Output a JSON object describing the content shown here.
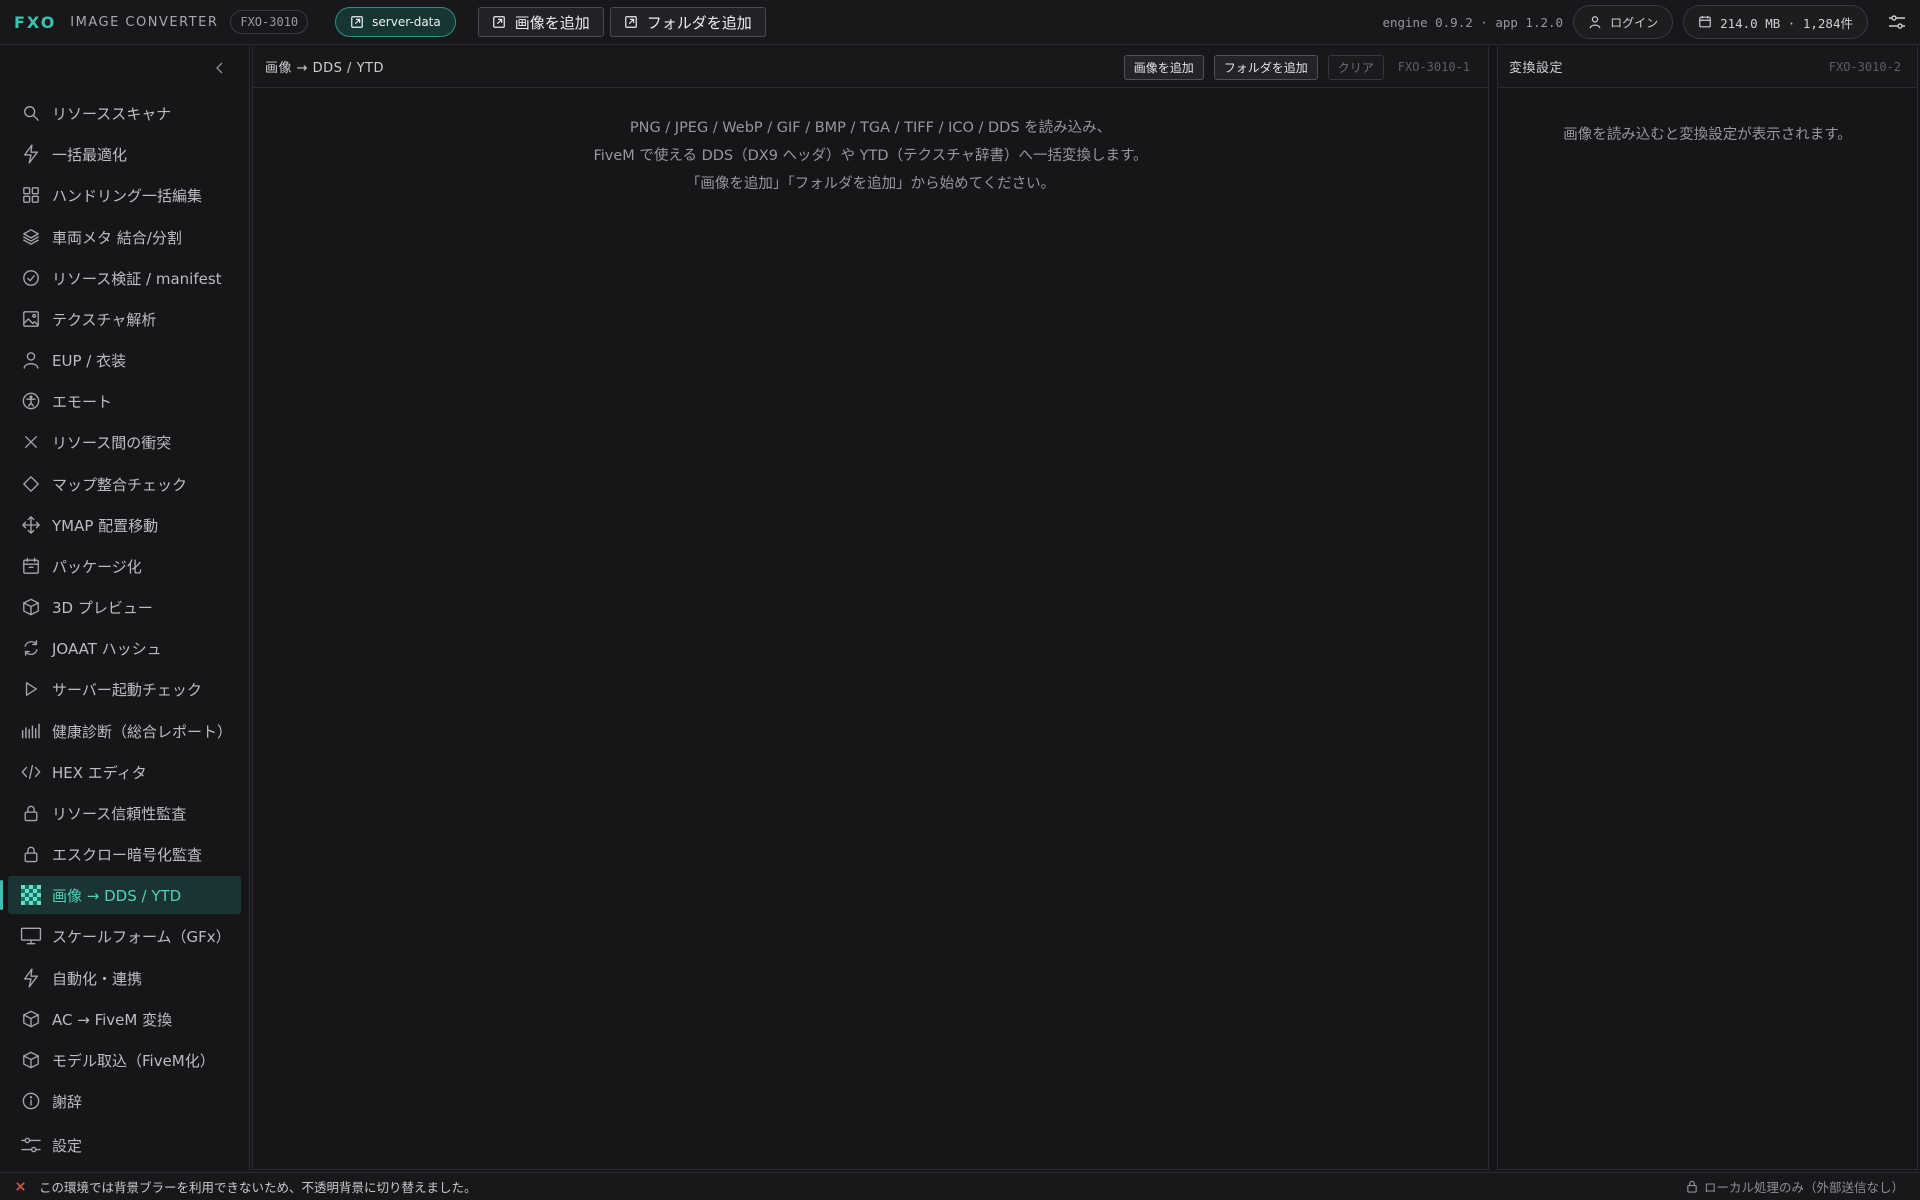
{
  "topbar": {
    "logo": "FXO",
    "app_name": "IMAGE CONVERTER",
    "app_code": "FXO-3010",
    "server_label": "server-data",
    "add_image_label": "画像を追加",
    "add_folder_label": "フォルダを追加",
    "version": "engine 0.9.2 · app 1.2.0",
    "login_label": "ログイン",
    "storage": "214.0 MB · 1,284件"
  },
  "sidebar": {
    "items": [
      {
        "label": "リソーススキャナ",
        "icon": "search-icon"
      },
      {
        "label": "一括最適化",
        "icon": "lightning-icon"
      },
      {
        "label": "ハンドリング一括編集",
        "icon": "grid-icon"
      },
      {
        "label": "車両メタ 結合/分割",
        "icon": "layers-icon"
      },
      {
        "label": "リソース検証 / manifest",
        "icon": "check-circle-icon"
      },
      {
        "label": "テクスチャ解析",
        "icon": "image-icon"
      },
      {
        "label": "EUP / 衣装",
        "icon": "user-icon"
      },
      {
        "label": "エモート",
        "icon": "accessibility-icon"
      },
      {
        "label": "リソース間の衝突",
        "icon": "x-icon"
      },
      {
        "label": "マップ整合チェック",
        "icon": "diamond-icon"
      },
      {
        "label": "YMAP 配置移動",
        "icon": "move-icon"
      },
      {
        "label": "パッケージ化",
        "icon": "package-icon"
      },
      {
        "label": "3D プレビュー",
        "icon": "cube-icon"
      },
      {
        "label": "JOAAT ハッシュ",
        "icon": "refresh-icon"
      },
      {
        "label": "サーバー起動チェック",
        "icon": "play-icon"
      },
      {
        "label": "健康診断（総合レポート）",
        "icon": "bars-icon"
      },
      {
        "label": "HEX エディタ",
        "icon": "code-icon"
      },
      {
        "label": "リソース信頼性監査",
        "icon": "lock-icon"
      },
      {
        "label": "エスクロー暗号化監査",
        "icon": "lock-icon"
      },
      {
        "label": "画像 → DDS / YTD",
        "icon": "checker-icon",
        "active": true
      },
      {
        "label": "スケールフォーム（GFx）",
        "icon": "monitor-icon"
      },
      {
        "label": "自動化・連携",
        "icon": "lightning-icon"
      },
      {
        "label": "AC → FiveM 変換",
        "icon": "cube-icon"
      },
      {
        "label": "モデル取込（FiveM化）",
        "icon": "cube-icon"
      },
      {
        "label": "謝辞",
        "icon": "info-icon"
      },
      {
        "label": "設定",
        "icon": "sliders-icon"
      }
    ]
  },
  "main": {
    "title": "画像 → DDS / YTD",
    "add_image": "画像を追加",
    "add_folder": "フォルダを追加",
    "clear": "クリア",
    "code": "FXO-3010-1",
    "empty_line1": "PNG / JPEG / WebP / GIF / BMP / TGA / TIFF / ICO / DDS を読み込み、",
    "empty_line2": "FiveM で使える DDS（DX9 ヘッダ）や YTD（テクスチャ辞書）へ一括変換します。",
    "empty_line3": "「画像を追加」「フォルダを追加」から始めてください。"
  },
  "settings_panel": {
    "title": "変換設定",
    "code": "FXO-3010-2",
    "empty": "画像を読み込むと変換設定が表示されます。"
  },
  "statusbar": {
    "message": "この環境では背景ブラーを利用できないため、不透明背景に切り替えました。",
    "local_only": "ローカル処理のみ（外部送信なし）"
  },
  "colors": {
    "accent": "#39c3b0",
    "error": "#e0524f"
  }
}
